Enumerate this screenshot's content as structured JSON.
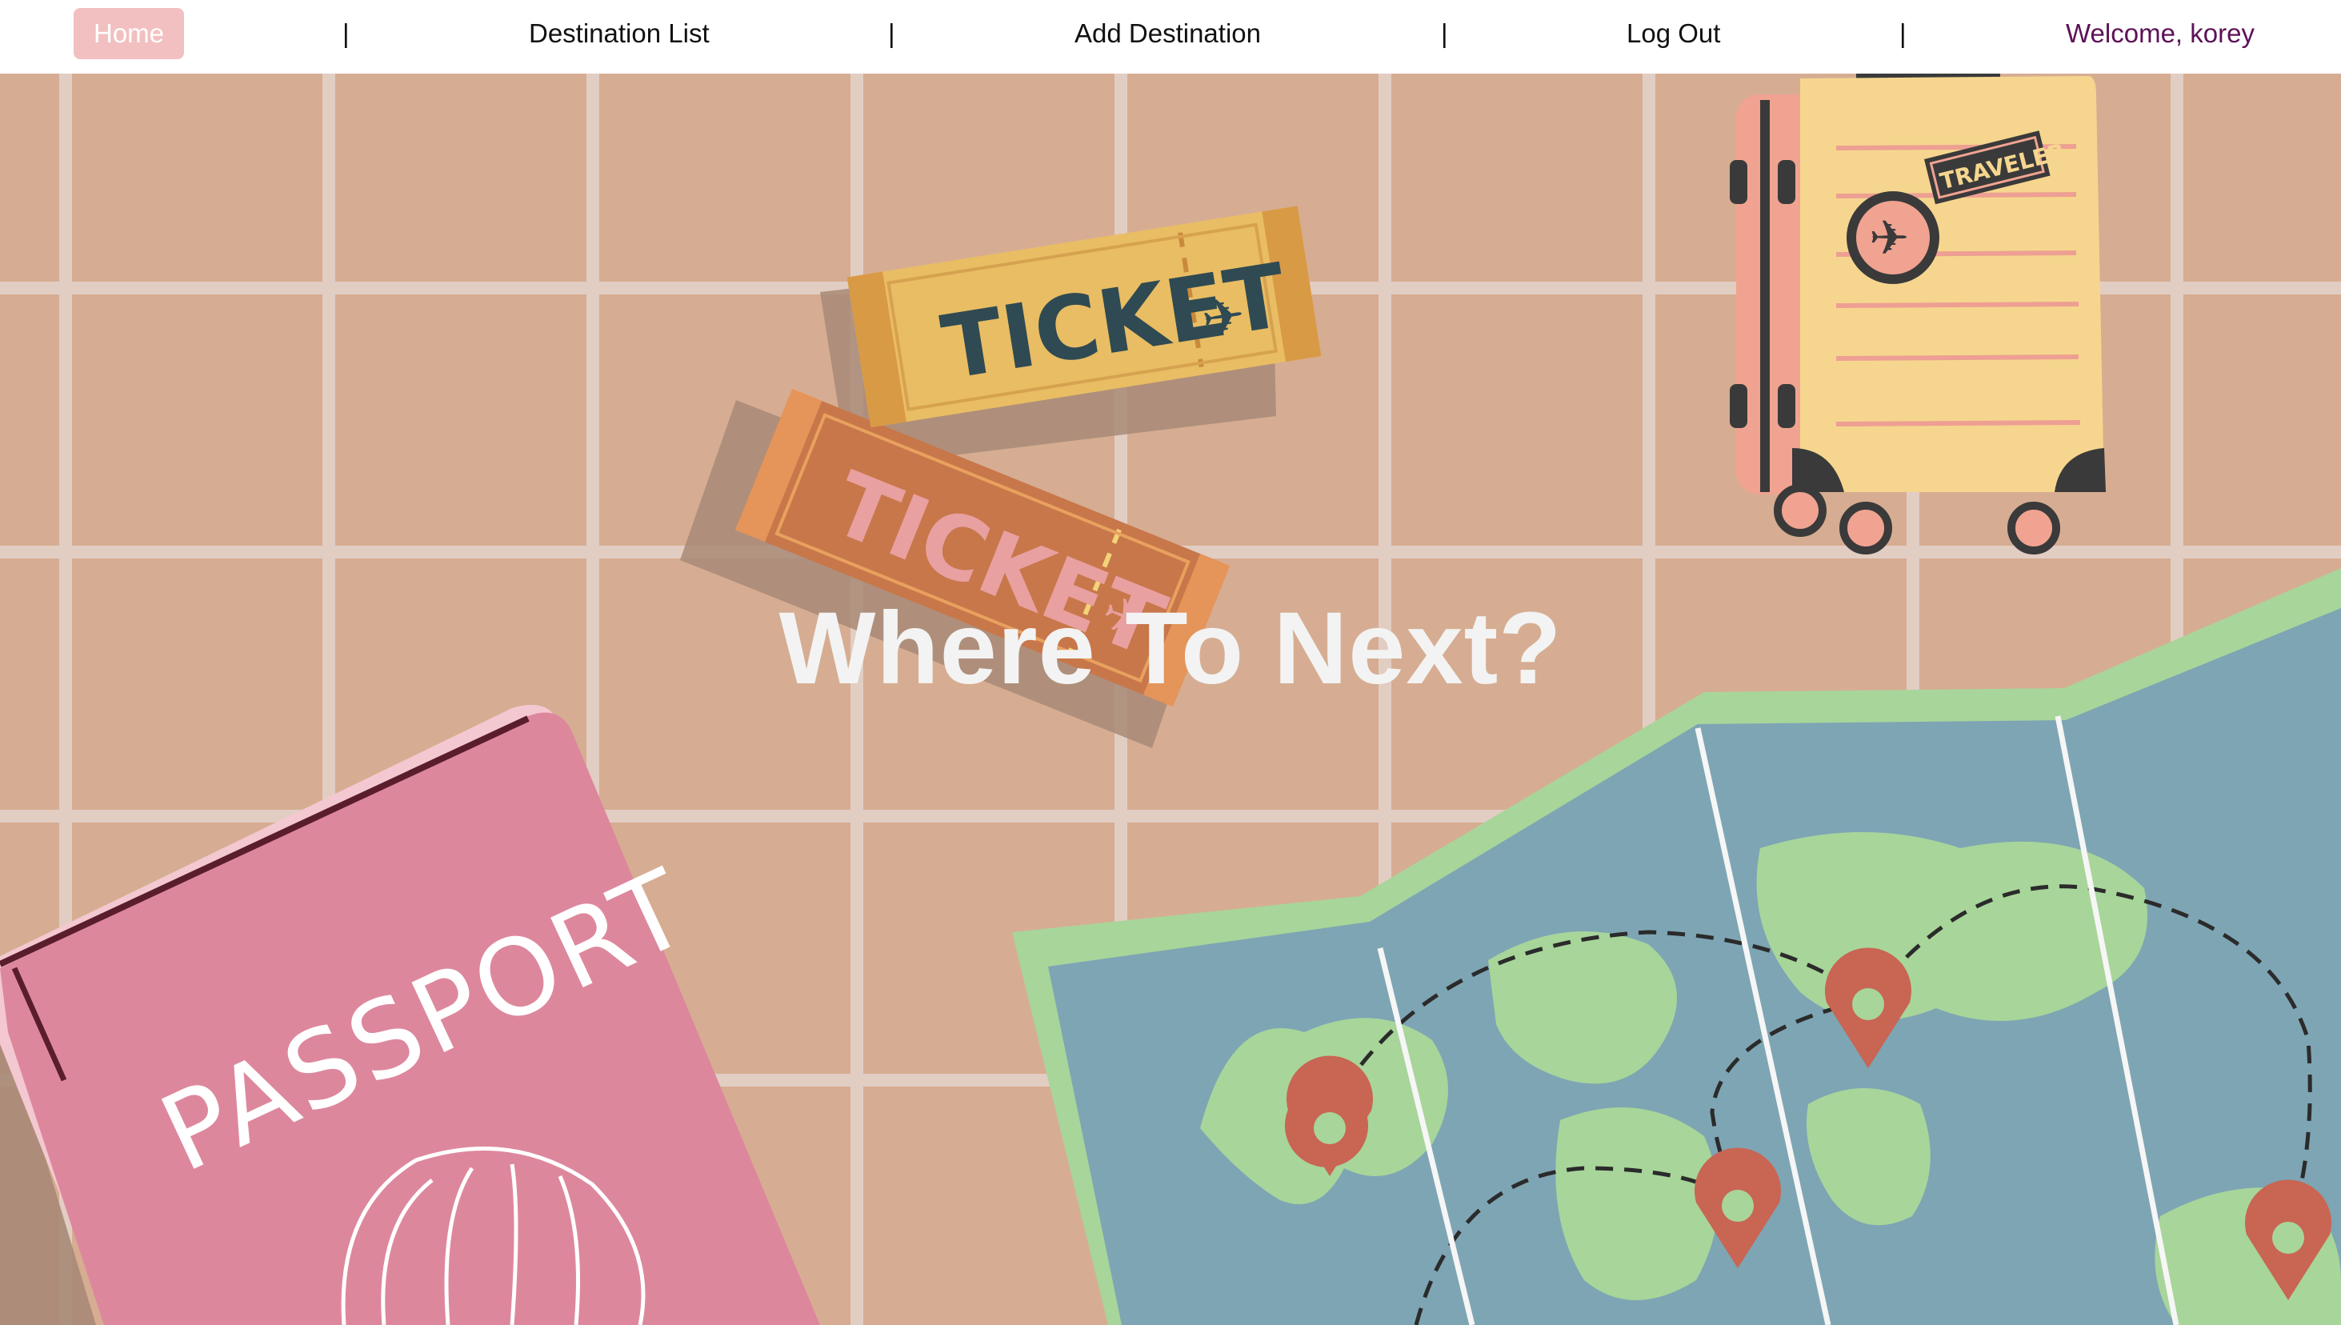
{
  "nav": {
    "home_label": "Home",
    "destination_list_label": "Destination List",
    "add_destination_label": "Add Destination",
    "logout_label": "Log Out",
    "separator": "|",
    "welcome_text": "Welcome, korey"
  },
  "hero": {
    "title": "Where To Next?",
    "ticket_text": "TICKET",
    "luggage_tag_text": "TRAVELER",
    "passport_text": "PASSPORT"
  },
  "colors": {
    "home_bg": "#f2c0c0",
    "welcome": "#5c1257",
    "background": "#d6ad92",
    "grid_line": "#e2cdc3"
  },
  "icons": [
    "ticket-icon",
    "suitcase-icon",
    "passport-icon",
    "world-map-icon",
    "location-pin-icon",
    "airplane-icon"
  ]
}
